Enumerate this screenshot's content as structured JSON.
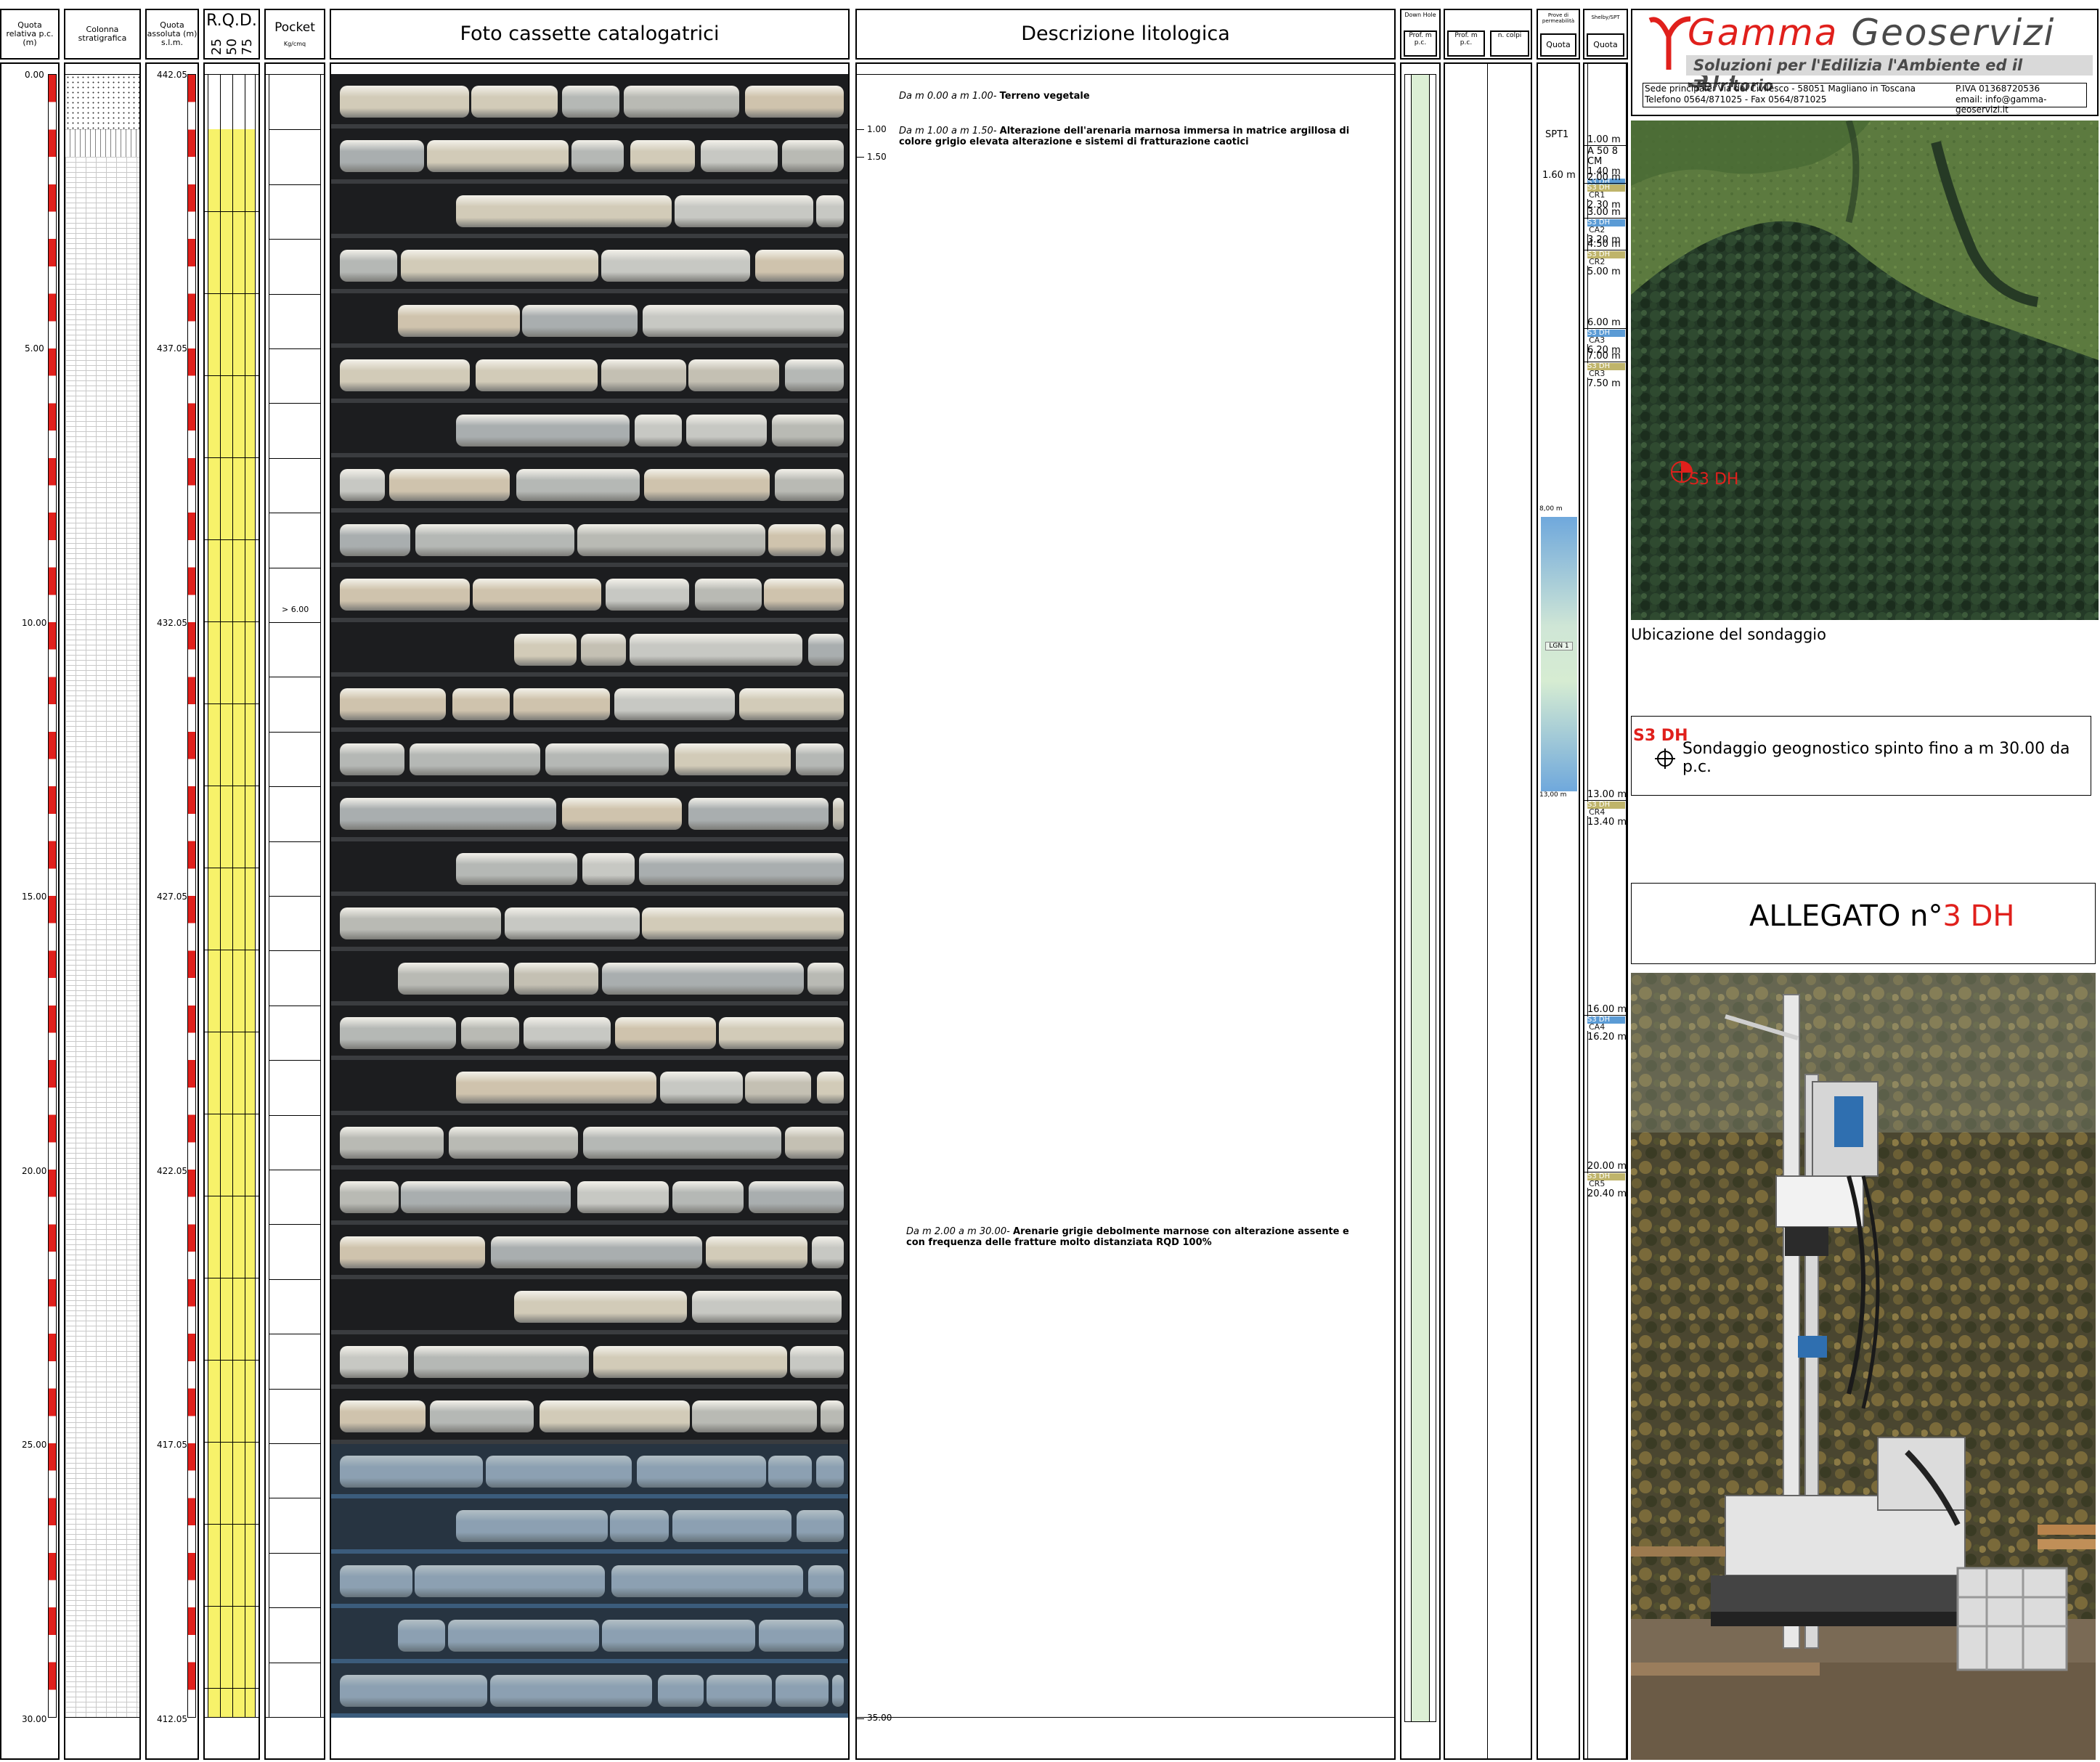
{
  "headers": {
    "quota_relativa": "Quota relativa p.c. (m)",
    "colonna": "Colonna stratigrafica",
    "quota_assoluta": "Quota assoluta (m) s.l.m.",
    "rqd": "R.Q.D.",
    "rqd_ticks": [
      "25",
      "50",
      "75"
    ],
    "pocket": "Pocket",
    "pocket_unit": "Kg/cmq",
    "foto": "Foto cassette catalogatrici",
    "descrizione": "Descrizione litologica",
    "down_hole": "Down Hole",
    "prof1": "Prof. m p.c.",
    "prof2": "Prof. m p.c.",
    "n_colpi": "n. colpi",
    "prove_perm": "Prove di permeabilità",
    "quota1": "Quota",
    "shelby": "Shelby/SPT",
    "quota2": "Quota"
  },
  "depth_labels": [
    "0.00",
    "5.00",
    "10.00",
    "15.00",
    "20.00",
    "25.00",
    "30.00"
  ],
  "abs_labels": [
    "442.05",
    "437.05",
    "432.05",
    "427.05",
    "422.05",
    "417.05",
    "412.05"
  ],
  "pocket_value": "> 6.00",
  "description_marks": [
    "1.00",
    "1.50",
    "35.00"
  ],
  "descriptions": [
    {
      "prefix": "Da m 0.00 a m 1.00-",
      "text": "Terreno vegetale"
    },
    {
      "prefix": "Da m 1.00 a m 1.50-",
      "text": "Alterazione dell'arenaria marnosa immersa in matrice argillosa di colore grigio elevata alterazione e sistemi di fratturazione caotici"
    },
    {
      "prefix": "Da m 2.00 a m 30.00-",
      "text": "Arenarie grigie debolmente marnose con alterazione assente e con frequenza delle fratture molto distanziata RQD 100%"
    }
  ],
  "spt": {
    "label": "SPT1",
    "quota": "1.60 m"
  },
  "perm": {
    "top": "8,00 m",
    "label": "LGN 1",
    "bottom": "13,00 m"
  },
  "samples": [
    {
      "top": "1.00 m",
      "label": "A 50 8 CM",
      "bottom": "1.40 m",
      "code": "S3 DH",
      "tag": "CA1"
    },
    {
      "top": "2.00 m",
      "code": "S3 DH",
      "tag": "CR1",
      "bottom": "2.30 m"
    },
    {
      "top": "3.00 m",
      "code": "S3 DH",
      "tag": "CA2",
      "bottom": "3.20 m"
    },
    {
      "top": "4.50 m",
      "code": "S3 DH",
      "tag": "CR2",
      "bottom": "5.00 m"
    },
    {
      "top": "6.00 m",
      "code": "S3 DH",
      "tag": "CA3",
      "bottom": "6.20 m"
    },
    {
      "top": "7.00 m",
      "code": "S3 DH",
      "tag": "CR3",
      "bottom": "7.50 m"
    },
    {
      "top": "13.00 m",
      "code": "S3 DH",
      "tag": "CR4",
      "bottom": "13.40 m"
    },
    {
      "top": "16.00 m",
      "code": "S3 DH",
      "tag": "CA4",
      "bottom": "16.20 m"
    },
    {
      "top": "20.00 m",
      "code": "S3 DH",
      "tag": "CR5",
      "bottom": "20.40 m"
    }
  ],
  "company": {
    "name_g": "Gamma",
    "name_rest": " Geoservizi Srl",
    "slogan": "Soluzioni per l'Edilizia l'Ambiente ed il Territorio",
    "address": "Sede principale: Via del Civilesco - 58051 Magliano in Toscana",
    "piva": "P.IVA 01368720536",
    "phone": "Telefono 0564/871025 - Fax 0564/871025",
    "email": "email: info@gamma-geoservizi.it"
  },
  "map": {
    "marker_label": "S3 DH",
    "caption": "Ubicazione del sondaggio"
  },
  "legend": {
    "code": "S3 DH",
    "text": "Sondaggio geognostico spinto fino a m 30.00 da p.c."
  },
  "allegato": {
    "prefix": "ALLEGATO n°",
    "number": "3 DH"
  },
  "colors": {
    "accent_red": "#e0201c",
    "rqd_yellow": "#f7f26a",
    "perm_blue": "#6fa8dc",
    "ca_blue": "#5b9bd5",
    "cr_olive": "#bfb46a"
  }
}
